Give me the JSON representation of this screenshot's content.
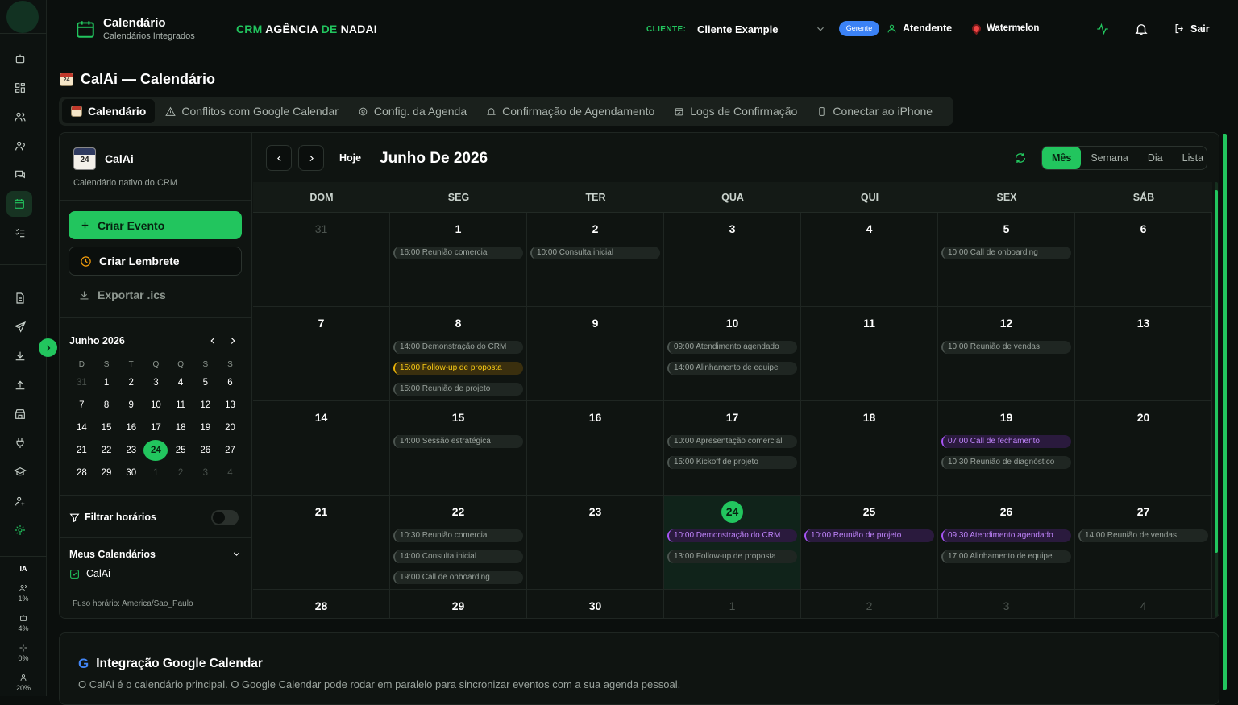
{
  "header": {
    "title": "Calendário",
    "subtitle": "Calendários Integrados",
    "agency_green": "CRM",
    "agency_white": "AGÊNCIA",
    "agency_de": "DE",
    "agency_nadai": "NADAI",
    "client_label": "CLIENTE:",
    "client_value": "Cliente Example",
    "role_badge": "Gerente",
    "user": "Atendente",
    "theme": "Watermelon",
    "logout": "Sair"
  },
  "page": {
    "title": "CalAi — Calendário",
    "icon_num": "24"
  },
  "tabs": [
    {
      "label": "Calendário",
      "icon": "calendar-icon"
    },
    {
      "label": "Conflitos com Google Calendar",
      "icon": "warning-icon"
    },
    {
      "label": "Config. da Agenda",
      "icon": "gear-icon"
    },
    {
      "label": "Confirmação de Agendamento",
      "icon": "bell-icon"
    },
    {
      "label": "Logs de Confirmação",
      "icon": "calendar-check-icon"
    },
    {
      "label": "Conectar ao iPhone",
      "icon": "phone-icon"
    }
  ],
  "sidebar": {
    "name": "CalAi",
    "icon_num": "24",
    "desc": "Calendário nativo do CRM",
    "create": "Criar Evento",
    "reminder": "Criar Lembrete",
    "export": "Exportar .ics",
    "mini_title": "Junho 2026",
    "weekdays": [
      "D",
      "S",
      "T",
      "Q",
      "Q",
      "S",
      "S"
    ],
    "mini_days": [
      [
        "31",
        "1",
        "2",
        "3",
        "4",
        "5",
        "6"
      ],
      [
        "7",
        "8",
        "9",
        "10",
        "11",
        "12",
        "13"
      ],
      [
        "14",
        "15",
        "16",
        "17",
        "18",
        "19",
        "20"
      ],
      [
        "21",
        "22",
        "23",
        "24",
        "25",
        "26",
        "27"
      ],
      [
        "28",
        "29",
        "30",
        "1",
        "2",
        "3",
        "4"
      ]
    ],
    "filter": "Filtrar horários",
    "my_calendars": "Meus Calendários",
    "calendar_item": "CalAi",
    "timezone": "Fuso horário: America/Sao_Paulo"
  },
  "calendar": {
    "today_btn": "Hoje",
    "month_title": "Junho De 2026",
    "views": [
      "Mês",
      "Semana",
      "Dia",
      "Lista"
    ],
    "dow": [
      "DOM",
      "SEG",
      "TER",
      "QUA",
      "QUI",
      "SEX",
      "SÁB"
    ],
    "weeks": [
      [
        {
          "d": "31",
          "o": true
        },
        {
          "d": "1",
          "ev": [
            [
              "16:00 Reunião comercial",
              ""
            ]
          ]
        },
        {
          "d": "2",
          "ev": [
            [
              "10:00 Consulta inicial",
              ""
            ]
          ]
        },
        {
          "d": "3"
        },
        {
          "d": "4"
        },
        {
          "d": "5",
          "ev": [
            [
              "10:00 Call de onboarding",
              ""
            ]
          ]
        },
        {
          "d": "6"
        }
      ],
      [
        {
          "d": "7"
        },
        {
          "d": "8",
          "ev": [
            [
              "14:00 Demonstração do CRM",
              ""
            ],
            [
              "15:00 Follow-up de proposta",
              "y"
            ],
            [
              "15:00 Reunião de projeto",
              ""
            ]
          ]
        },
        {
          "d": "9"
        },
        {
          "d": "10",
          "ev": [
            [
              "09:00 Atendimento agendado",
              ""
            ],
            [
              "14:00 Alinhamento de equipe",
              ""
            ]
          ]
        },
        {
          "d": "11"
        },
        {
          "d": "12",
          "ev": [
            [
              "10:00 Reunião de vendas",
              ""
            ]
          ]
        },
        {
          "d": "13"
        }
      ],
      [
        {
          "d": "14"
        },
        {
          "d": "15",
          "ev": [
            [
              "14:00 Sessão estratégica",
              ""
            ]
          ]
        },
        {
          "d": "16"
        },
        {
          "d": "17",
          "ev": [
            [
              "10:00 Apresentação comercial",
              ""
            ],
            [
              "15:00 Kickoff de projeto",
              ""
            ]
          ]
        },
        {
          "d": "18"
        },
        {
          "d": "19",
          "ev": [
            [
              "07:00 Call de fechamento",
              "p"
            ],
            [
              "10:30 Reunião de diagnóstico",
              ""
            ]
          ]
        },
        {
          "d": "20"
        }
      ],
      [
        {
          "d": "21"
        },
        {
          "d": "22",
          "ev": [
            [
              "10:30 Reunião comercial",
              ""
            ],
            [
              "14:00 Consulta inicial",
              ""
            ],
            [
              "19:00 Call de onboarding",
              ""
            ]
          ]
        },
        {
          "d": "23"
        },
        {
          "d": "24",
          "t": true,
          "ev": [
            [
              "10:00 Demonstração do CRM",
              "p"
            ],
            [
              "13:00 Follow-up de proposta",
              ""
            ]
          ]
        },
        {
          "d": "25",
          "ev": [
            [
              "10:00 Reunião de projeto",
              "p"
            ]
          ]
        },
        {
          "d": "26",
          "ev": [
            [
              "09:30 Atendimento agendado",
              "p"
            ],
            [
              "17:00 Alinhamento de equipe",
              ""
            ]
          ]
        },
        {
          "d": "27",
          "ev": [
            [
              "14:00 Reunião de vendas",
              ""
            ]
          ]
        }
      ],
      [
        {
          "d": "28"
        },
        {
          "d": "29"
        },
        {
          "d": "30"
        },
        {
          "d": "1",
          "o": true
        },
        {
          "d": "2",
          "o": true
        },
        {
          "d": "3",
          "o": true
        },
        {
          "d": "4",
          "o": true
        }
      ]
    ]
  },
  "rail_stats": [
    {
      "icon": "users-icon",
      "value": "1%"
    },
    {
      "icon": "bot-icon",
      "value": "4%"
    },
    {
      "icon": "sparkle-icon",
      "value": "0%"
    },
    {
      "icon": "user-icon",
      "value": "20%"
    }
  ],
  "rail_ia": "IA",
  "google": {
    "g": "G",
    "title": "Integração Google Calendar",
    "desc": "O CalAi é o calendário principal. O Google Calendar pode rodar em paralelo para sincronizar eventos com a sua agenda pessoal."
  },
  "colors": {
    "accent": "#22c55e",
    "yellow": "#eab308",
    "purple": "#a855f7",
    "badge": "#3b82f6"
  }
}
